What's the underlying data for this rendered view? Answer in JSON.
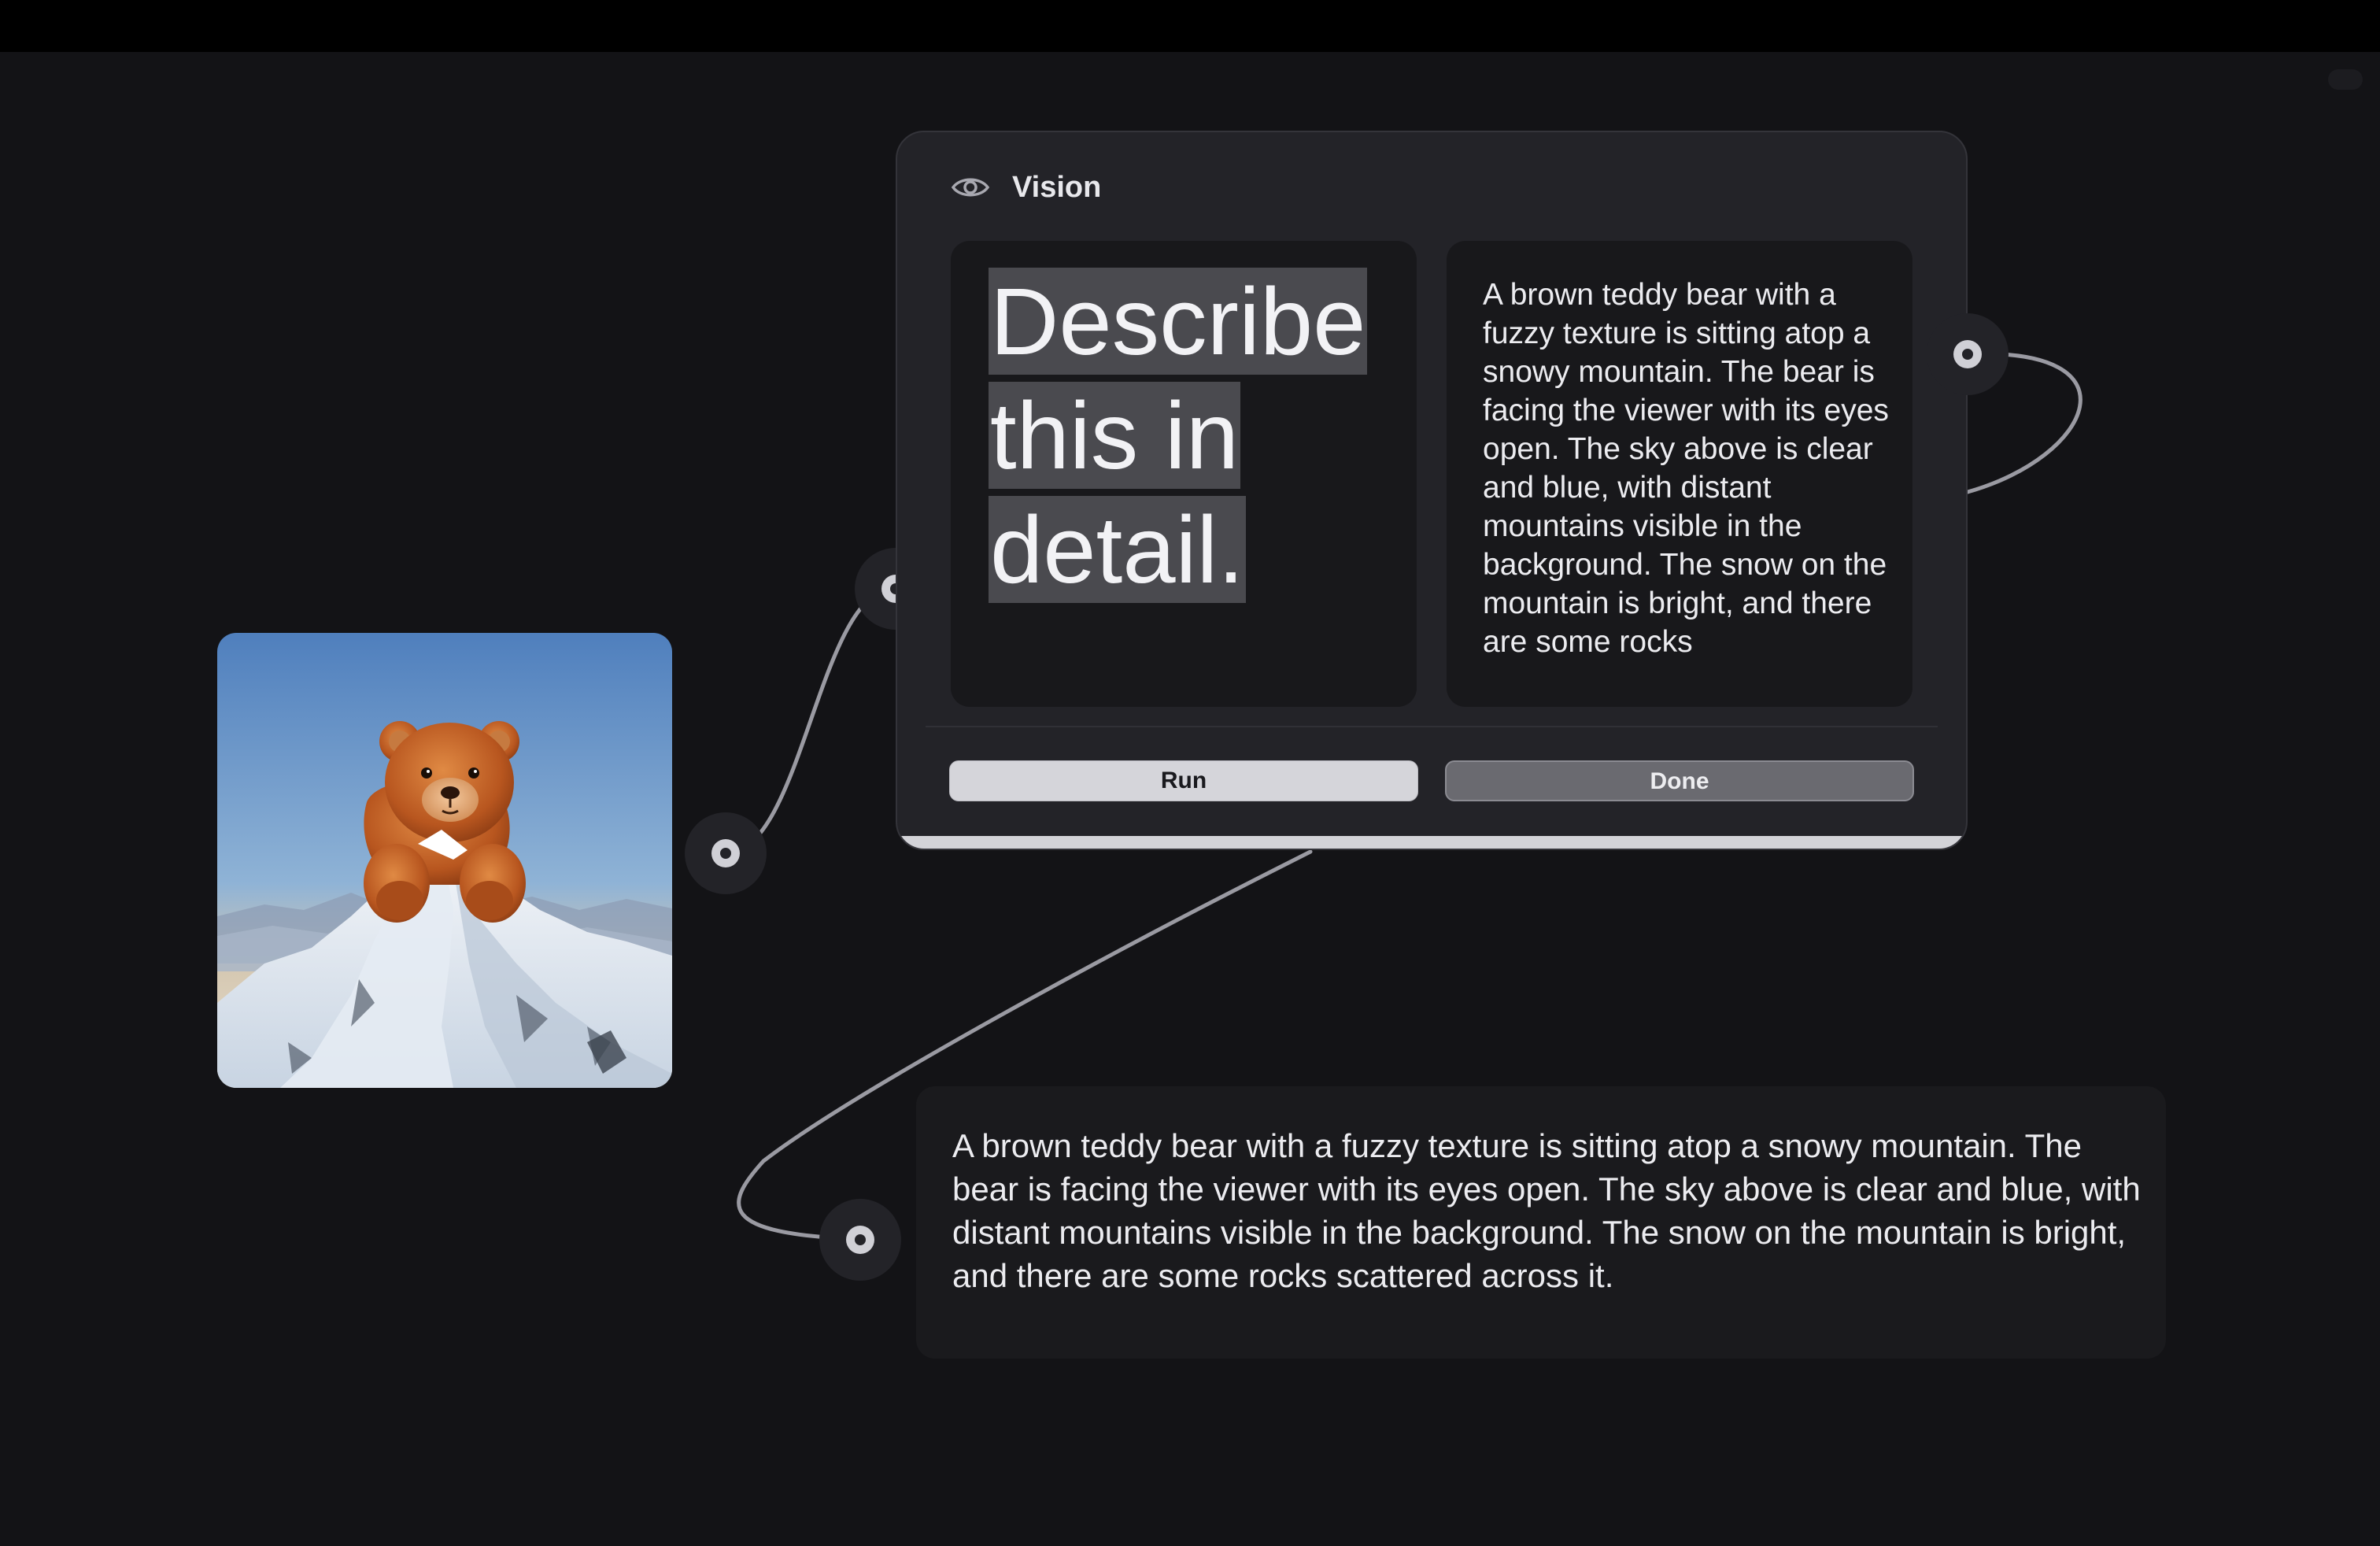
{
  "canvas": {
    "background": "#131316",
    "wire_color": "#9a9aa2"
  },
  "image_node": {
    "icon": "image-thumbnail",
    "subject": "teddy bear on snowy mountain peak"
  },
  "vision_node": {
    "icon": "eye-icon",
    "title": "Vision",
    "prompt": "Describe this in detail.",
    "output_preview": "A brown teddy bear with a fuzzy texture is sitting atop a snowy mountain. The bear is facing the viewer with its eyes open. The sky above is clear and blue, with distant mountains visible in the background. The snow on the mountain is bright, and there are some rocks",
    "buttons": {
      "run": "Run",
      "done": "Done"
    }
  },
  "result_node": {
    "text": "A brown teddy bear with a fuzzy texture is sitting atop a snowy mountain. The bear is facing the viewer with its eyes open. The sky above is clear and blue, with distant mountains visible in the background. The snow on the mountain is bright, and there are some rocks scattered across it."
  }
}
